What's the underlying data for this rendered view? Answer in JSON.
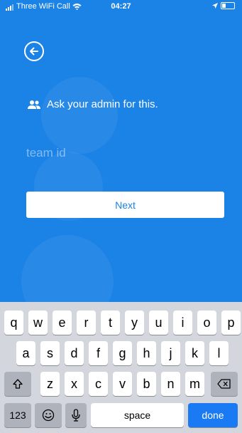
{
  "status_bar": {
    "carrier": "Three WiFi Call",
    "time": "04:27"
  },
  "screen": {
    "hint_text": "Ask your admin for this.",
    "team_id_placeholder": "team id",
    "next_label": "Next",
    "icons": {
      "back": "arrow-left-circle-icon",
      "people": "people-icon"
    },
    "accent_color": "#1b82e6"
  },
  "keyboard": {
    "row1": [
      "q",
      "w",
      "e",
      "r",
      "t",
      "y",
      "u",
      "i",
      "o",
      "p"
    ],
    "row2": [
      "a",
      "s",
      "d",
      "f",
      "g",
      "h",
      "j",
      "k",
      "l"
    ],
    "row3": [
      "z",
      "x",
      "c",
      "v",
      "b",
      "n",
      "m"
    ],
    "numbers_label": "123",
    "space_label": "space",
    "done_label": "done",
    "done_color": "#1a7af3"
  }
}
